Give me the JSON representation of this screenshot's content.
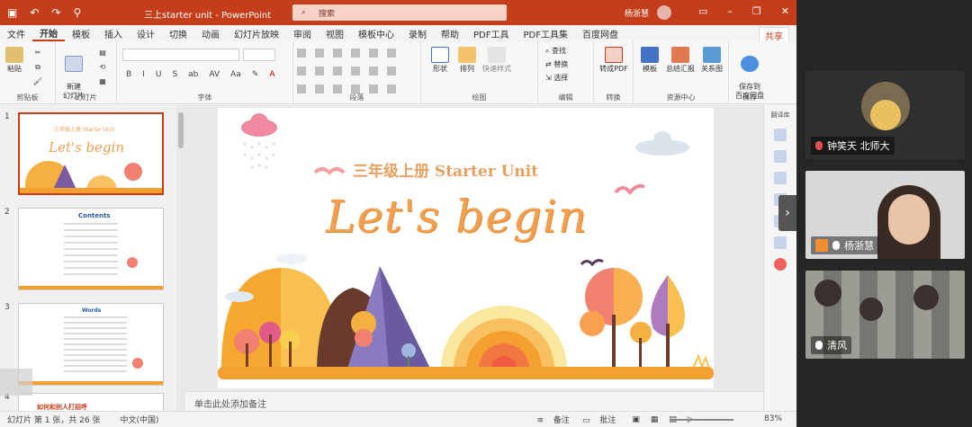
{
  "titlebar": {
    "doc_title": "三上starter unit - PowerPoint",
    "search_placeholder": "搜索",
    "user_name": "杨浙慧"
  },
  "menu": [
    "文件",
    "开始",
    "模板",
    "插入",
    "设计",
    "切换",
    "动画",
    "幻灯片放映",
    "审阅",
    "视图",
    "模板中心",
    "录制",
    "帮助",
    "PDF工具",
    "PDF工具集",
    "百度网盘"
  ],
  "share_label": "共享",
  "ribbon": {
    "groups": {
      "clipboard": "剪贴板",
      "slides": "幻灯片",
      "font": "字体",
      "paragraph": "段落",
      "drawing": "绘图",
      "editing": "编辑",
      "convert": "转换",
      "resource": "资源中心",
      "save": "保存"
    },
    "buttons": {
      "paste": "粘贴",
      "new_slide": "新建\n幻灯片",
      "shape": "形状",
      "arrange": "排列",
      "quick_style": "快速样式",
      "find": "查找",
      "replace": "替换",
      "select": "选择",
      "to_pdf": "转成PDF",
      "template": "模板",
      "report": "总结汇报",
      "relation": "关系图",
      "save_baidu": "保存到\n百度网盘"
    }
  },
  "slides": [
    {
      "num": "1",
      "subtitle": "三年级上册 Starter Unit",
      "title": "Let's begin"
    },
    {
      "num": "2",
      "title": "Contents"
    },
    {
      "num": "3",
      "title": "Words"
    },
    {
      "num": "4",
      "title": "如何和别人打招呼"
    }
  ],
  "main_slide": {
    "subtitle": "三年级上册  Starter Unit",
    "title": "Let's begin"
  },
  "notes_placeholder": "单击此处添加备注",
  "rail_label": "翻译库",
  "statusbar": {
    "slide_info": "幻灯片 第 1 张，共 26 张",
    "language": "中文(中国)",
    "notes": "备注",
    "comments": "批注",
    "zoom": "83%"
  },
  "meeting": {
    "participants": [
      {
        "name": "钟笑天 北师大"
      },
      {
        "name": "杨浙慧"
      },
      {
        "name": "清风"
      }
    ]
  },
  "colors": {
    "accent": "#c43e1c",
    "slide_orange": "#f0a050"
  }
}
